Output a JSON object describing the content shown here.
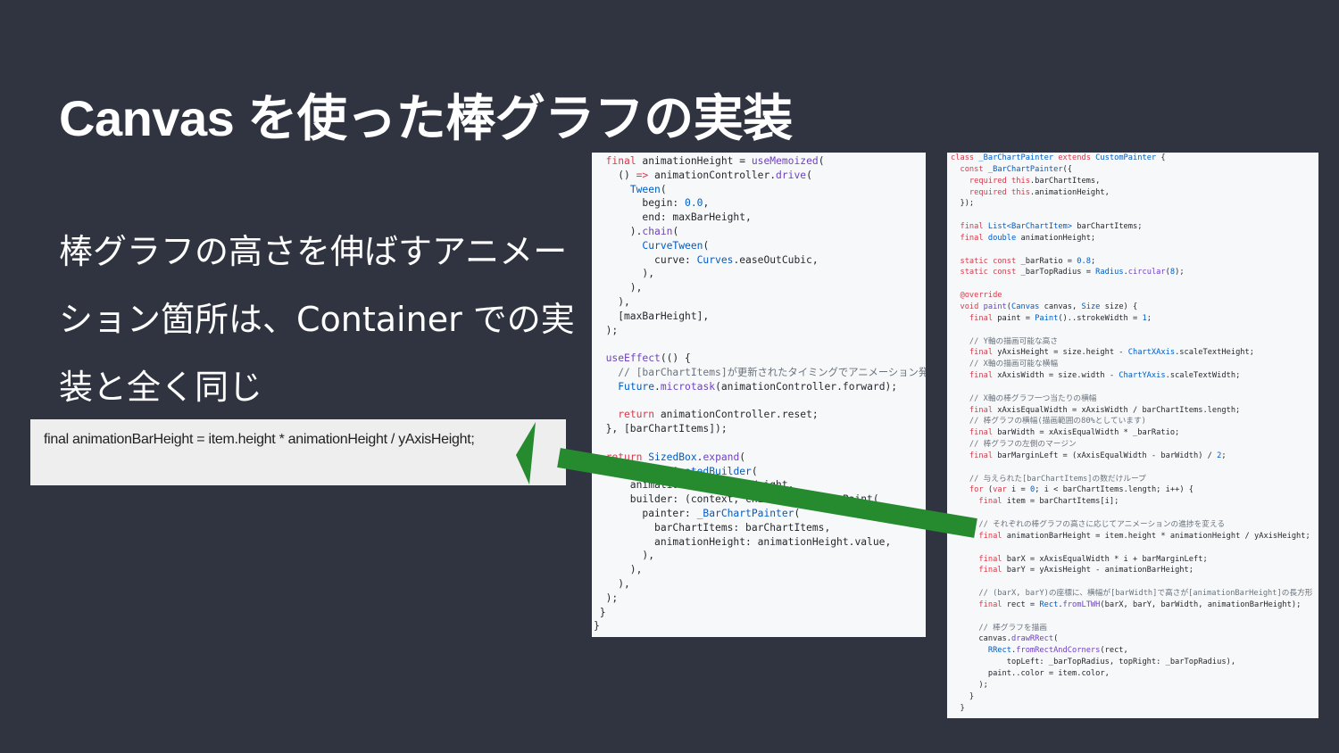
{
  "slide": {
    "title": "Canvas を使った棒グラフの実装",
    "body_lines": [
      "棒グラフの高さを伸ばすアニメー",
      "ション箇所は、Container での実",
      "装と全く同じ"
    ],
    "snippet": "final animationBarHeight = item.height * animationHeight / yAxisHeight;"
  },
  "colors": {
    "background": "#2f3440",
    "arrow": "#268a2e",
    "keyword": "#d73a49",
    "type": "#005cc5",
    "comment": "#6a737d"
  },
  "code_left": [
    [
      [
        "  ",
        ""
      ],
      [
        "final",
        "kw"
      ],
      [
        " animationHeight = ",
        ""
      ],
      [
        "useMemoized",
        "fn"
      ],
      [
        "(",
        ""
      ]
    ],
    [
      [
        "    () ",
        ""
      ],
      [
        "=>",
        "kw"
      ],
      [
        " animationController.",
        ""
      ],
      [
        "drive",
        "fn"
      ],
      [
        "(",
        ""
      ]
    ],
    [
      [
        "      ",
        ""
      ],
      [
        "Tween",
        "ty"
      ],
      [
        "(",
        ""
      ]
    ],
    [
      [
        "        begin: ",
        ""
      ],
      [
        "0.0",
        "num"
      ],
      [
        ",",
        ""
      ]
    ],
    [
      [
        "        end: maxBarHeight,",
        ""
      ]
    ],
    [
      [
        "      ).",
        ""
      ],
      [
        "chain",
        "fn"
      ],
      [
        "(",
        ""
      ]
    ],
    [
      [
        "        ",
        ""
      ],
      [
        "CurveTween",
        "ty"
      ],
      [
        "(",
        ""
      ]
    ],
    [
      [
        "          curve: ",
        ""
      ],
      [
        "Curves",
        "ty"
      ],
      [
        ".easeOutCubic,",
        ""
      ]
    ],
    [
      [
        "        ),",
        ""
      ]
    ],
    [
      [
        "      ),",
        ""
      ]
    ],
    [
      [
        "    ),",
        ""
      ]
    ],
    [
      [
        "    [maxBarHeight],",
        ""
      ]
    ],
    [
      [
        "  );",
        ""
      ]
    ],
    [
      [
        "",
        ""
      ]
    ],
    [
      [
        "  ",
        ""
      ],
      [
        "useEffect",
        "fn"
      ],
      [
        "(() {",
        ""
      ]
    ],
    [
      [
        "    // [barChartItems]が更新されたタイミングでアニメーション発火",
        "cm"
      ]
    ],
    [
      [
        "    ",
        ""
      ],
      [
        "Future",
        "ty"
      ],
      [
        ".",
        ""
      ],
      [
        "microtask",
        "fn"
      ],
      [
        "(animationController.forward);",
        ""
      ]
    ],
    [
      [
        "",
        ""
      ]
    ],
    [
      [
        "    ",
        ""
      ],
      [
        "return",
        "kw"
      ],
      [
        " animationController.reset;",
        ""
      ]
    ],
    [
      [
        "  }, [barChartItems]);",
        ""
      ]
    ],
    [
      [
        "",
        ""
      ]
    ],
    [
      [
        "  ",
        ""
      ],
      [
        "return",
        "kw"
      ],
      [
        " ",
        ""
      ],
      [
        "SizedBox",
        "ty"
      ],
      [
        ".",
        ""
      ],
      [
        "expand",
        "fn"
      ],
      [
        "(",
        ""
      ]
    ],
    [
      [
        "    child: ",
        ""
      ],
      [
        "AnimatedBuilder",
        "ty"
      ],
      [
        "(",
        ""
      ]
    ],
    [
      [
        "      animation: animationHeight,",
        ""
      ]
    ],
    [
      [
        "      builder: (context, child) => CustomPaint(",
        ""
      ]
    ],
    [
      [
        "        painter: ",
        ""
      ],
      [
        "_BarChartPainter",
        "ty"
      ],
      [
        "(",
        ""
      ]
    ],
    [
      [
        "          barChartItems: barChartItems,",
        ""
      ]
    ],
    [
      [
        "          animationHeight: animationHeight.value,",
        ""
      ]
    ],
    [
      [
        "        ),",
        ""
      ]
    ],
    [
      [
        "      ),",
        ""
      ]
    ],
    [
      [
        "    ),",
        ""
      ]
    ],
    [
      [
        "  );",
        ""
      ]
    ],
    [
      [
        " }",
        ""
      ]
    ],
    [
      [
        "}",
        ""
      ]
    ]
  ],
  "code_right": [
    [
      [
        "class",
        "kw"
      ],
      [
        " ",
        ""
      ],
      [
        "_BarChartPainter",
        "ty"
      ],
      [
        " ",
        ""
      ],
      [
        "extends",
        "kw"
      ],
      [
        " ",
        ""
      ],
      [
        "CustomPainter",
        "ty"
      ],
      [
        " {",
        ""
      ]
    ],
    [
      [
        "  ",
        ""
      ],
      [
        "const",
        "kw"
      ],
      [
        " ",
        ""
      ],
      [
        "_BarChartPainter",
        "ty"
      ],
      [
        "({",
        ""
      ]
    ],
    [
      [
        "    ",
        ""
      ],
      [
        "required",
        "kw"
      ],
      [
        " ",
        ""
      ],
      [
        "this",
        "kw"
      ],
      [
        ".barChartItems,",
        ""
      ]
    ],
    [
      [
        "    ",
        ""
      ],
      [
        "required",
        "kw"
      ],
      [
        " ",
        ""
      ],
      [
        "this",
        "kw"
      ],
      [
        ".animationHeight,",
        ""
      ]
    ],
    [
      [
        "  });",
        ""
      ]
    ],
    [
      [
        "",
        ""
      ]
    ],
    [
      [
        "  ",
        ""
      ],
      [
        "final",
        "kw"
      ],
      [
        " ",
        ""
      ],
      [
        "List<BarChartItem>",
        "ty"
      ],
      [
        " barChartItems;",
        ""
      ]
    ],
    [
      [
        "  ",
        ""
      ],
      [
        "final",
        "kw"
      ],
      [
        " ",
        ""
      ],
      [
        "double",
        "ty"
      ],
      [
        " animationHeight;",
        ""
      ]
    ],
    [
      [
        "",
        ""
      ]
    ],
    [
      [
        "  ",
        ""
      ],
      [
        "static",
        "kw"
      ],
      [
        " ",
        ""
      ],
      [
        "const",
        "kw"
      ],
      [
        " _barRatio = ",
        ""
      ],
      [
        "0.8",
        "num"
      ],
      [
        ";",
        ""
      ]
    ],
    [
      [
        "  ",
        ""
      ],
      [
        "static",
        "kw"
      ],
      [
        " ",
        ""
      ],
      [
        "const",
        "kw"
      ],
      [
        " _barTopRadius = ",
        ""
      ],
      [
        "Radius",
        "ty"
      ],
      [
        ".",
        ""
      ],
      [
        "circular",
        "fn"
      ],
      [
        "(",
        ""
      ],
      [
        "8",
        "num"
      ],
      [
        ");",
        ""
      ]
    ],
    [
      [
        "",
        ""
      ]
    ],
    [
      [
        "  ",
        ""
      ],
      [
        "@override",
        "kw"
      ]
    ],
    [
      [
        "  ",
        ""
      ],
      [
        "void",
        "kw"
      ],
      [
        " ",
        ""
      ],
      [
        "paint",
        "fn"
      ],
      [
        "(",
        ""
      ],
      [
        "Canvas",
        "ty"
      ],
      [
        " canvas, ",
        ""
      ],
      [
        "Size",
        "ty"
      ],
      [
        " size) {",
        ""
      ]
    ],
    [
      [
        "    ",
        ""
      ],
      [
        "final",
        "kw"
      ],
      [
        " paint = ",
        ""
      ],
      [
        "Paint",
        "ty"
      ],
      [
        "()..strokeWidth = ",
        ""
      ],
      [
        "1",
        "num"
      ],
      [
        ";",
        ""
      ]
    ],
    [
      [
        "",
        ""
      ]
    ],
    [
      [
        "    // Y軸の描画可能な高さ",
        "cm"
      ]
    ],
    [
      [
        "    ",
        ""
      ],
      [
        "final",
        "kw"
      ],
      [
        " yAxisHeight = size.height - ",
        ""
      ],
      [
        "ChartXAxis",
        "ty"
      ],
      [
        ".scaleTextHeight;",
        ""
      ]
    ],
    [
      [
        "    // X軸の描画可能な横幅",
        "cm"
      ]
    ],
    [
      [
        "    ",
        ""
      ],
      [
        "final",
        "kw"
      ],
      [
        " xAxisWidth = size.width - ",
        ""
      ],
      [
        "ChartYAxis",
        "ty"
      ],
      [
        ".scaleTextWidth;",
        ""
      ]
    ],
    [
      [
        "",
        ""
      ]
    ],
    [
      [
        "    // X軸の棒グラフ一つ当たりの横幅",
        "cm"
      ]
    ],
    [
      [
        "    ",
        ""
      ],
      [
        "final",
        "kw"
      ],
      [
        " xAxisEqualWidth = xAxisWidth / barChartItems.length;",
        ""
      ]
    ],
    [
      [
        "    // 棒グラフの横幅(描画範囲の80%としています)",
        "cm"
      ]
    ],
    [
      [
        "    ",
        ""
      ],
      [
        "final",
        "kw"
      ],
      [
        " barWidth = xAxisEqualWidth * _barRatio;",
        ""
      ]
    ],
    [
      [
        "    // 棒グラフの左側のマージン",
        "cm"
      ]
    ],
    [
      [
        "    ",
        ""
      ],
      [
        "final",
        "kw"
      ],
      [
        " barMarginLeft = (xAxisEqualWidth - barWidth) / ",
        ""
      ],
      [
        "2",
        "num"
      ],
      [
        ";",
        ""
      ]
    ],
    [
      [
        "",
        ""
      ]
    ],
    [
      [
        "    // 与えられた[barChartItems]の数だけループ",
        "cm"
      ]
    ],
    [
      [
        "    ",
        ""
      ],
      [
        "for",
        "kw"
      ],
      [
        " (",
        ""
      ],
      [
        "var",
        "kw"
      ],
      [
        " i = ",
        ""
      ],
      [
        "0",
        "num"
      ],
      [
        "; i < barChartItems.length; i++) {",
        ""
      ]
    ],
    [
      [
        "      ",
        ""
      ],
      [
        "final",
        "kw"
      ],
      [
        " item = barChartItems[i];",
        ""
      ]
    ],
    [
      [
        "",
        ""
      ]
    ],
    [
      [
        "      // それぞれの棒グラフの高さに応じてアニメーションの進捗を変える",
        "cm"
      ]
    ],
    [
      [
        "      ",
        ""
      ],
      [
        "final",
        "kw"
      ],
      [
        " animationBarHeight = item.height * animationHeight / yAxisHeight;",
        ""
      ]
    ],
    [
      [
        "",
        ""
      ]
    ],
    [
      [
        "      ",
        ""
      ],
      [
        "final",
        "kw"
      ],
      [
        " barX = xAxisEqualWidth * i + barMarginLeft;",
        ""
      ]
    ],
    [
      [
        "      ",
        ""
      ],
      [
        "final",
        "kw"
      ],
      [
        " barY = yAxisHeight - animationBarHeight;",
        ""
      ]
    ],
    [
      [
        "",
        ""
      ]
    ],
    [
      [
        "      // (barX, barY)の座標に、横幅が[barWidth]で高さが[animationBarHeight]の長方形",
        "cm"
      ]
    ],
    [
      [
        "      ",
        ""
      ],
      [
        "final",
        "kw"
      ],
      [
        " rect = ",
        ""
      ],
      [
        "Rect",
        "ty"
      ],
      [
        ".",
        ""
      ],
      [
        "fromLTWH",
        "fn"
      ],
      [
        "(barX, barY, barWidth, animationBarHeight);",
        ""
      ]
    ],
    [
      [
        "",
        ""
      ]
    ],
    [
      [
        "      // 棒グラフを描画",
        "cm"
      ]
    ],
    [
      [
        "      canvas.",
        ""
      ],
      [
        "drawRRect",
        "fn"
      ],
      [
        "(",
        ""
      ]
    ],
    [
      [
        "        ",
        ""
      ],
      [
        "RRect",
        "ty"
      ],
      [
        ".",
        ""
      ],
      [
        "fromRectAndCorners",
        "fn"
      ],
      [
        "(rect,",
        ""
      ]
    ],
    [
      [
        "            topLeft: _barTopRadius, topRight: _barTopRadius),",
        ""
      ]
    ],
    [
      [
        "        paint..color = item.color,",
        ""
      ]
    ],
    [
      [
        "      );",
        ""
      ]
    ],
    [
      [
        "    }",
        ""
      ]
    ],
    [
      [
        "  }",
        ""
      ]
    ]
  ]
}
